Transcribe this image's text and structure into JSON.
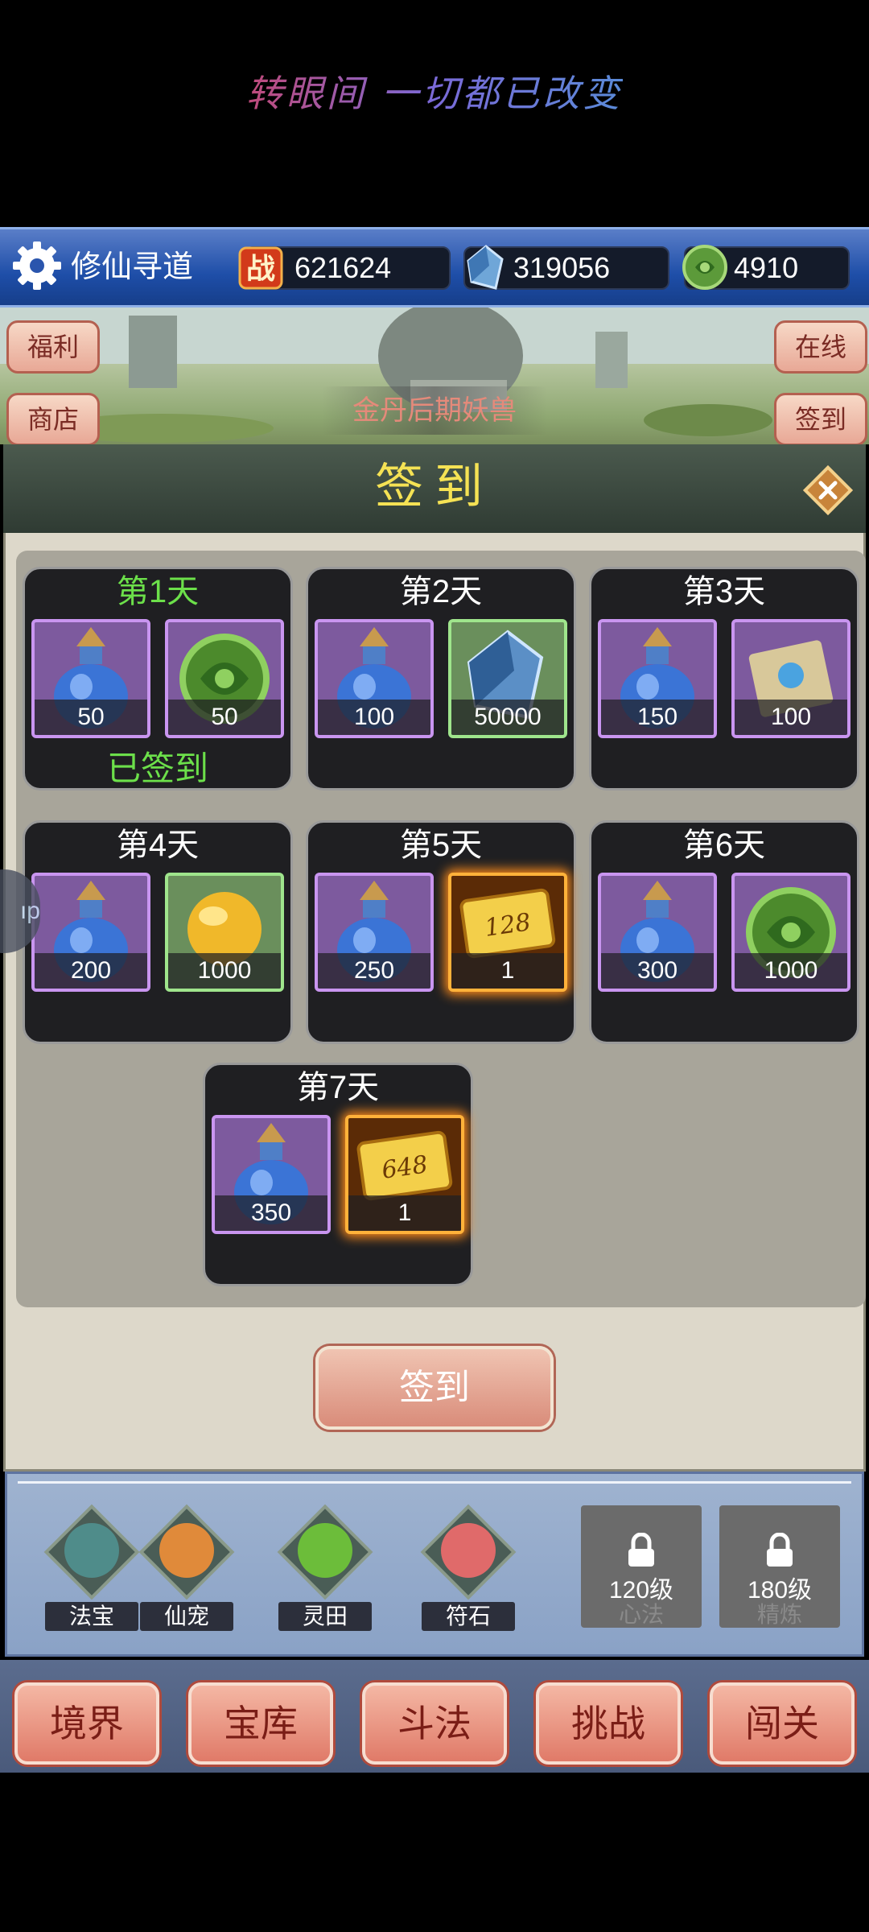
{
  "banner": "转眼间 一切都已改变",
  "topbar": {
    "app_name": "修仙寻道",
    "resources": [
      {
        "icon": "battle-power-icon",
        "value": "621624"
      },
      {
        "icon": "crystal-icon",
        "value": "319056"
      },
      {
        "icon": "jade-coin-icon",
        "value": "4910"
      }
    ]
  },
  "scene": {
    "left_buttons": [
      "福利",
      "商店"
    ],
    "right_buttons": [
      "在线",
      "签到"
    ],
    "stage": "金丹后期妖兽"
  },
  "side_tab": "ıp",
  "signin": {
    "title": "签到",
    "signed_label": "已签到",
    "days": [
      {
        "label": "第1天",
        "signed": true,
        "items": [
          {
            "icon": "blue-potion-icon",
            "count": "50"
          },
          {
            "icon": "jade-coin-icon",
            "count": "50"
          }
        ]
      },
      {
        "label": "第2天",
        "signed": false,
        "items": [
          {
            "icon": "blue-potion-icon",
            "count": "100"
          },
          {
            "icon": "crystal-icon",
            "count": "50000"
          }
        ]
      },
      {
        "label": "第3天",
        "signed": false,
        "items": [
          {
            "icon": "blue-potion-icon",
            "count": "150"
          },
          {
            "icon": "scroll-icon",
            "count": "100"
          }
        ]
      },
      {
        "label": "第4天",
        "signed": false,
        "items": [
          {
            "icon": "blue-potion-icon",
            "count": "200"
          },
          {
            "icon": "gold-orb-icon",
            "count": "1000"
          }
        ]
      },
      {
        "label": "第5天",
        "signed": false,
        "items": [
          {
            "icon": "blue-potion-icon",
            "count": "250"
          },
          {
            "icon": "gold-ticket-icon",
            "count": "1",
            "ticket": "128"
          }
        ]
      },
      {
        "label": "第6天",
        "signed": false,
        "items": [
          {
            "icon": "blue-potion-icon",
            "count": "300"
          },
          {
            "icon": "jade-coin-icon",
            "count": "1000"
          }
        ]
      },
      {
        "label": "第7天",
        "signed": false,
        "items": [
          {
            "icon": "blue-potion-icon",
            "count": "350"
          },
          {
            "icon": "gold-ticket-icon",
            "count": "1",
            "ticket": "648"
          }
        ]
      }
    ],
    "button": "签到"
  },
  "features": [
    {
      "label": "法宝",
      "icon": "treasure-icon"
    },
    {
      "label": "仙宠",
      "icon": "pet-cat-icon"
    },
    {
      "label": "灵田",
      "icon": "field-plant-icon"
    },
    {
      "label": "符石",
      "icon": "rune-stone-icon"
    }
  ],
  "locked_features": [
    {
      "level": "120级",
      "label": "心法"
    },
    {
      "level": "180级",
      "label": "精炼"
    }
  ],
  "nav": [
    "境界",
    "宝库",
    "斗法",
    "挑战",
    "闯关"
  ]
}
